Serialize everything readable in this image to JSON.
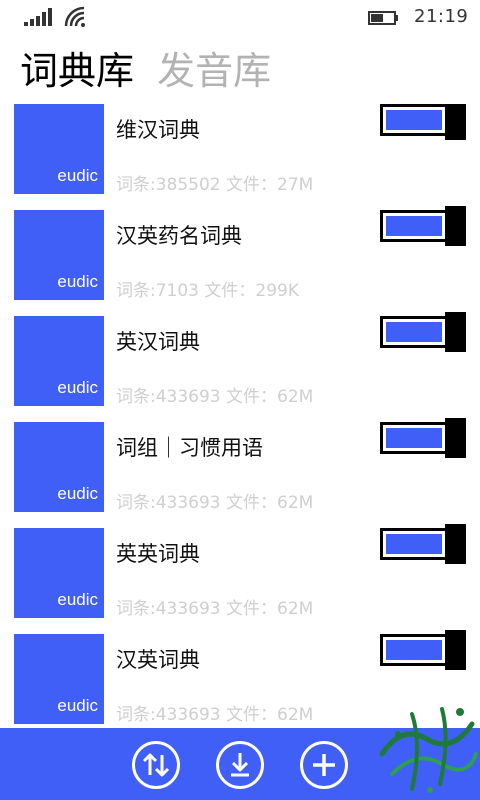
{
  "status": {
    "time": "21:19"
  },
  "pivot": {
    "tabs": [
      {
        "label": "词典库",
        "active": true
      },
      {
        "label": "发音库",
        "active": false
      }
    ]
  },
  "dictionaries": [
    {
      "tile_label": "eudic",
      "name": "维汉词典",
      "meta": "词条:385502 文件：27M",
      "enabled": true
    },
    {
      "tile_label": "eudic",
      "name": "汉英药名词典",
      "meta": "词条:7103 文件：299K",
      "enabled": true
    },
    {
      "tile_label": "eudic",
      "name": "英汉词典",
      "meta": "词条:433693 文件：62M",
      "enabled": true
    },
    {
      "tile_label": "eudic",
      "name": "词组｜习惯用语",
      "meta": "词条:433693 文件：62M",
      "enabled": true
    },
    {
      "tile_label": "eudic",
      "name": "英英词典",
      "meta": "词条:433693 文件：62M",
      "enabled": true
    },
    {
      "tile_label": "eudic",
      "name": "汉英词典",
      "meta": "词条:433693 文件：62M",
      "enabled": true
    }
  ],
  "appbar": {
    "buttons": [
      {
        "icon": "sort-icon"
      },
      {
        "icon": "download-icon"
      },
      {
        "icon": "add-icon"
      }
    ]
  },
  "colors": {
    "accent": "#3f5ff7",
    "inactive_tab": "#b3b3b3",
    "meta_text": "#cfcfcf"
  }
}
